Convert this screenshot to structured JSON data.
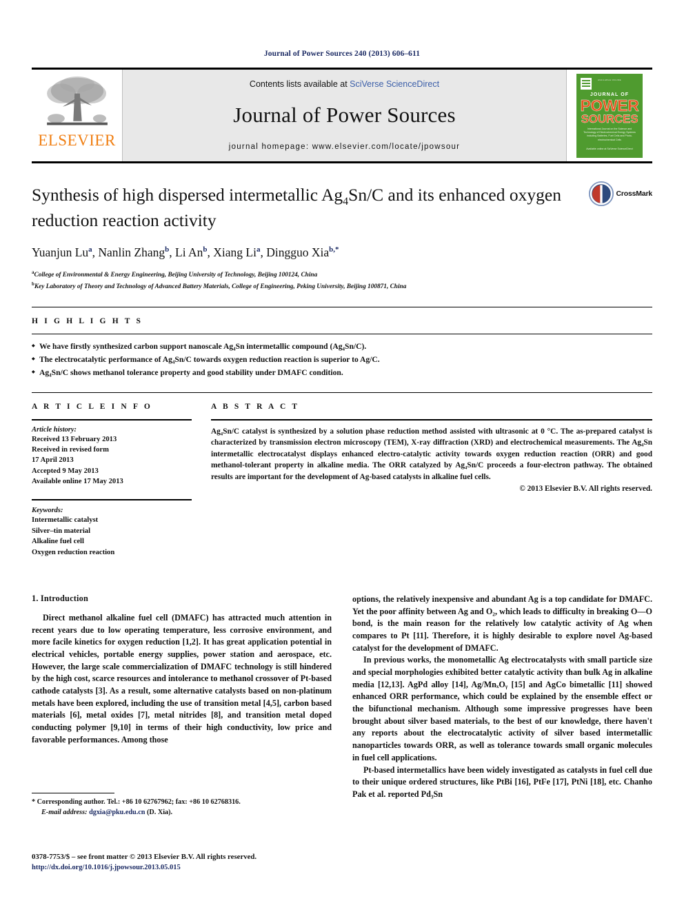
{
  "running_head": "Journal of Power Sources 240 (2013) 606–611",
  "masthead": {
    "publisher_logo_text": "ELSEVIER",
    "contents_prefix": "Contents lists available at ",
    "contents_link": "SciVerse ScienceDirect",
    "journal_name": "Journal of Power Sources",
    "homepage": "journal homepage: www.elsevier.com/locate/jpowsour",
    "cover": {
      "top_small": "AVAILABLE ONLINE",
      "journal_of": "JOURNAL OF",
      "power": "POWER",
      "sources": "SOURCES",
      "blurb": "International Journal on the Science and Technology of Electrochemical Energy Systems including Batteries, Fuel Cells and Photo-electrochemical Cells",
      "footer": "Available online at\nSciVerse ScienceDirect"
    }
  },
  "article": {
    "title_line1": "Synthesis of high dispersed intermetallic Ag",
    "title_sub1": "4",
    "title_line1b": "Sn/C and its enhanced",
    "title_line2": "oxygen reduction reaction activity",
    "authors_html": "Yuanjun Lu, Nanlin Zhang, Li An, Xiang Li, Dingguo Xia",
    "authors": [
      {
        "name": "Yuanjun Lu",
        "mark": "a"
      },
      {
        "name": "Nanlin Zhang",
        "mark": "b"
      },
      {
        "name": "Li An",
        "mark": "b"
      },
      {
        "name": "Xiang Li",
        "mark": "a"
      },
      {
        "name": "Dingguo Xia",
        "mark": "b,*"
      }
    ],
    "affiliations": [
      {
        "mark": "a",
        "text": "College of Environmental & Energy Engineering, Beijing University of Technology, Beijing 100124, China"
      },
      {
        "mark": "b",
        "text": "Key Laboratory of Theory and Technology of Advanced Battery Materials, College of Engineering, Peking University, Beijing 100871, China"
      }
    ],
    "crossmark_label": "CrossMark"
  },
  "highlights": {
    "heading": "H I G H L I G H T S",
    "items": [
      "We have firstly synthesized carbon support nanoscale Ag₄Sn intermetallic compound (Ag₄Sn/C).",
      "The electrocatalytic performance of Ag₄Sn/C towards oxygen reduction reaction is superior to Ag/C.",
      "Ag₄Sn/C shows methanol tolerance property and good stability under DMAFC condition."
    ]
  },
  "article_info": {
    "heading": "A R T I C L E   I N F O",
    "history_label": "Article history:",
    "history": [
      "Received 13 February 2013",
      "Received in revised form",
      "17 April 2013",
      "Accepted 9 May 2013",
      "Available online 17 May 2013"
    ],
    "keywords_label": "Keywords:",
    "keywords": [
      "Intermetallic catalyst",
      "Silver–tin material",
      "Alkaline fuel cell",
      "Oxygen reduction reaction"
    ]
  },
  "abstract": {
    "heading": "A B S T R A C T",
    "text": "Ag₄Sn/C catalyst is synthesized by a solution phase reduction method assisted with ultrasonic at 0 °C. The as-prepared catalyst is characterized by transmission electron microscopy (TEM), X-ray diffraction (XRD) and electrochemical measurements. The Ag₄Sn intermetallic electrocatalyst displays enhanced electro-catalytic activity towards oxygen reduction reaction (ORR) and good methanol-tolerant property in alkaline media. The ORR catalyzed by Ag₄Sn/C proceeds a four-electron pathway. The obtained results are important for the development of Ag-based catalysts in alkaline fuel cells.",
    "copyright": "© 2013 Elsevier B.V. All rights reserved."
  },
  "body": {
    "section_title": "1.  Introduction",
    "left_para1": "Direct methanol alkaline fuel cell (DMAFC) has attracted much attention in recent years due to low operating temperature, less corrosive environment, and more facile kinetics for oxygen reduction [1,2]. It has great application potential in electrical vehicles, portable energy supplies, power station and aerospace, etc. However, the large scale commercialization of DMAFC technology is still hindered by the high cost, scarce resources and intolerance to methanol crossover of Pt-based cathode catalysts [3]. As a result, some alternative catalysts based on non-platinum metals have been explored, including the use of transition metal [4,5], carbon based materials [6], metal oxides [7], metal nitrides [8], and transition metal doped conducting polymer [9,10] in terms of their high conductivity, low price and favorable performances. Among those",
    "right_para1": "options, the relatively inexpensive and abundant Ag is a top candidate for DMAFC. Yet the poor affinity between Ag and O₂, which leads to difficulty in breaking O—O bond, is the main reason for the relatively low catalytic activity of Ag when compares to Pt [11]. Therefore, it is highly desirable to explore novel Ag-based catalyst for the development of DMAFC.",
    "right_para2": "In previous works, the monometallic Ag electrocatalysts with small particle size and special morphologies exhibited better catalytic activity than bulk Ag in alkaline media [12,13]. AgPd alloy [14], Ag/MnₓOᵧ [15] and AgCo bimetallic [11] showed enhanced ORR performance, which could be explained by the ensemble effect or the bifunctional mechanism. Although some impressive progresses have been brought about silver based materials, to the best of our knowledge, there haven't any reports about the electrocatalytic activity of silver based intermetallic nanoparticles towards ORR, as well as tolerance towards small organic molecules in fuel cell applications.",
    "right_para3": "Pt-based intermetallics have been widely investigated as catalysts in fuel cell due to their unique ordered structures, like PtBi [16], PtFe [17], PtNi [18], etc. Chanho Pak et al. reported Pd₃Sn"
  },
  "footnotes": {
    "corresponding": "* Corresponding author. Tel.: +86 10 62767962; fax: +86 10 62768316.",
    "email_label": "E-mail address:",
    "email": "dgxia@pku.edu.cn",
    "email_suffix": " (D. Xia).",
    "issn": "0378-7753/$ – see front matter © 2013 Elsevier B.V. All rights reserved.",
    "doi": "http://dx.doi.org/10.1016/j.jpowsour.2013.05.015"
  },
  "colors": {
    "link": "#1b2a63",
    "elsevier_orange": "#f07f13",
    "cover_green": "#4f9b2f",
    "cover_orange": "#e8541f",
    "sciencedirect_blue": "#3b5ea8"
  }
}
